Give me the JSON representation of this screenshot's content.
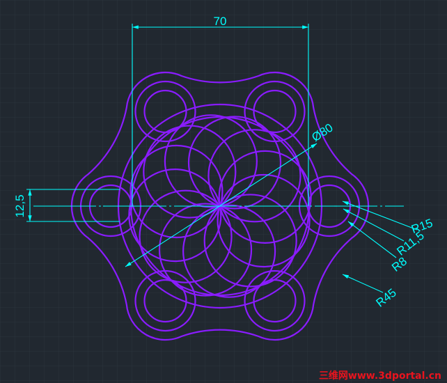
{
  "drawing": {
    "colors": {
      "background": "#212830",
      "grid": "#2c343d",
      "geometry": "#8a1cff",
      "dimension": "#00ffff",
      "watermark": "#e8141e"
    }
  },
  "dimensions": {
    "width_70": "70",
    "diameter_80": "Ø80",
    "height_12_5": "12,5",
    "radius_15": "R15",
    "radius_11_5": "R11,5",
    "radius_8": "R8",
    "radius_45": "R45"
  },
  "watermark": {
    "text": "三维网www.3dportal.cn"
  }
}
